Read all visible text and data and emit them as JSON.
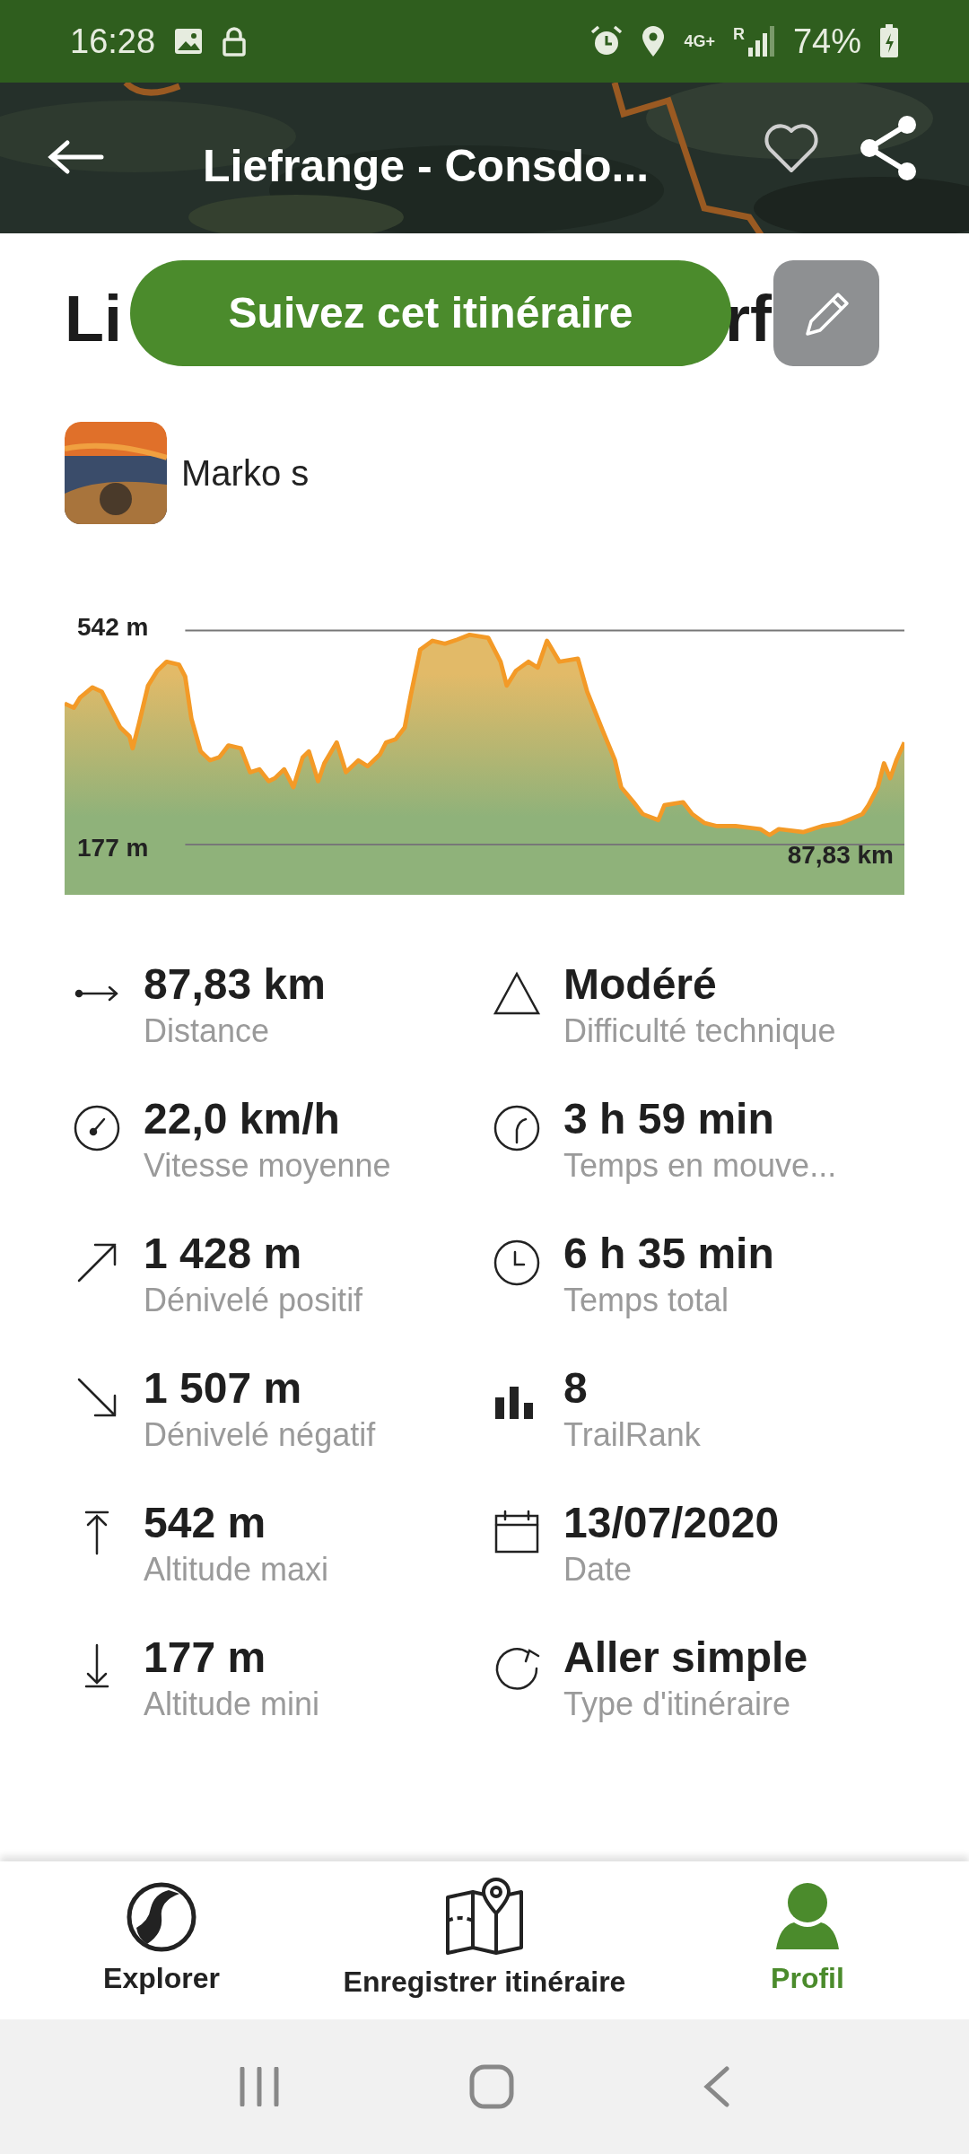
{
  "status_bar": {
    "time": "16:28",
    "network": "4G+",
    "roaming": "R",
    "battery": "74%"
  },
  "header": {
    "title": "Liefrange - Consdo...",
    "favorite": false
  },
  "title": {
    "start": "Li",
    "end": "rf"
  },
  "follow_button": "Suivez cet itinéraire",
  "author": {
    "name": "Marko s"
  },
  "elevation_profile": {
    "max_label": "542 m",
    "min_label": "177 m",
    "distance_label": "87,83 km"
  },
  "stats": [
    {
      "kind": "distance",
      "value": "87,83 km",
      "label": "Distance"
    },
    {
      "kind": "difficulty",
      "value": "Modéré",
      "label": "Difficulté technique"
    },
    {
      "kind": "speed",
      "value": "22,0 km/h",
      "label": "Vitesse moyenne"
    },
    {
      "kind": "moving_time",
      "value": "3 h 59 min",
      "label": "Temps en mouve..."
    },
    {
      "kind": "ascent",
      "value": "1 428 m",
      "label": "Dénivelé positif"
    },
    {
      "kind": "total_time",
      "value": "6 h 35 min",
      "label": "Temps total"
    },
    {
      "kind": "descent",
      "value": "1 507 m",
      "label": "Dénivelé négatif"
    },
    {
      "kind": "rank",
      "value": "8",
      "label": "TrailRank"
    },
    {
      "kind": "max_altitude",
      "value": "542 m",
      "label": "Altitude maxi"
    },
    {
      "kind": "date",
      "value": "13/07/2020",
      "label": "Date"
    },
    {
      "kind": "min_altitude",
      "value": "177 m",
      "label": "Altitude mini"
    },
    {
      "kind": "route_type",
      "value": "Aller simple",
      "label": "Type d'itinéraire"
    }
  ],
  "bottom_nav": [
    {
      "kind": "explore",
      "label": "Explorer",
      "selected": false
    },
    {
      "kind": "record",
      "label": "Enregistrer itinéraire",
      "selected": false
    },
    {
      "kind": "profile",
      "label": "Profil",
      "selected": true
    }
  ]
}
